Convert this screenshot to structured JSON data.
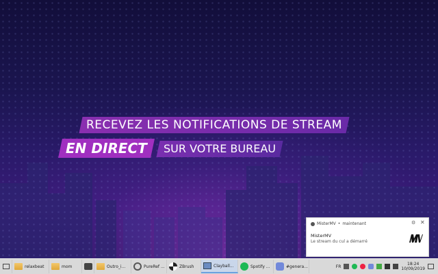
{
  "banner": {
    "line1": "RECEVEZ LES NOTIFICATIONS DE STREAM",
    "line2_bold": "EN DIRECT",
    "line2_rest": "SUR VOTRE BUREAU"
  },
  "notification": {
    "app": "MisterMV",
    "time": "maintenant",
    "title": "MisterMV",
    "message": "Le stream du cul a démarré"
  },
  "taskbar": {
    "items": [
      {
        "label": "relaxbeat",
        "icon": "folder-icon"
      },
      {
        "label": "mom",
        "icon": "folder-icon"
      },
      {
        "label": "Outro_i...",
        "icon": "folder-icon"
      },
      {
        "label": "PureRef ...",
        "icon": "pureref-icon"
      },
      {
        "label": "ZBrush",
        "icon": "zbrush-icon"
      },
      {
        "label": "Clayball...",
        "icon": "photo-icon"
      },
      {
        "label": "Spotify ...",
        "icon": "spotify-icon"
      },
      {
        "label": "#genera...",
        "icon": "discord-icon"
      }
    ],
    "lang": "FR",
    "time": "18:24",
    "date": "10/09/2019"
  },
  "colors": {
    "accent": "#a02fc0",
    "taskbar": "#d9d9d9"
  }
}
